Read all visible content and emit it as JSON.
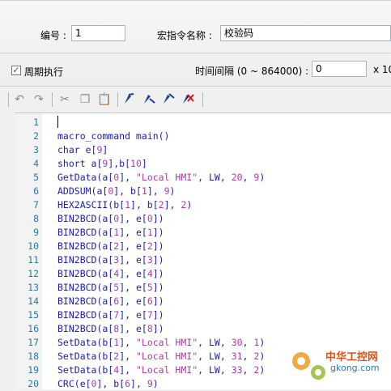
{
  "form": {
    "number_label": "编号 :",
    "number_value": "1",
    "macro_name_label": "宏指令名称 :",
    "macro_name_value": "校验码",
    "periodic_label": "周期执行",
    "periodic_checked": true,
    "interval_label": "时间间隔 (0 ~ 864000) :",
    "interval_value": "0",
    "interval_unit": "x 10"
  },
  "toolbar": {
    "items": [
      "undo-icon",
      "redo-icon",
      "cut-icon",
      "copy-icon",
      "paste-icon",
      "bookmark-icon",
      "bookmark-next-icon",
      "bookmark-prev-icon",
      "bookmark-clear-icon"
    ]
  },
  "editor": {
    "lines": [
      {
        "n": "1",
        "t": ""
      },
      {
        "n": "2",
        "t": "macro_command main()"
      },
      {
        "n": "3",
        "t": "char e[9]"
      },
      {
        "n": "4",
        "t": "short a[9],b[10]"
      },
      {
        "n": "5",
        "t": "GetData(a[0], \"Local HMI\", LW, 20, 9)"
      },
      {
        "n": "6",
        "t": "ADDSUM(a[0], b[1], 9)"
      },
      {
        "n": "7",
        "t": "HEX2ASCII(b[1], b[2], 2)"
      },
      {
        "n": "8",
        "t": "BIN2BCD(a[0], e[0])"
      },
      {
        "n": "9",
        "t": "BIN2BCD(a[1], e[1])"
      },
      {
        "n": "10",
        "t": "BIN2BCD(a[2], e[2])"
      },
      {
        "n": "11",
        "t": "BIN2BCD(a[3], e[3])"
      },
      {
        "n": "12",
        "t": "BIN2BCD(a[4], e[4])"
      },
      {
        "n": "13",
        "t": "BIN2BCD(a[5], e[5])"
      },
      {
        "n": "14",
        "t": "BIN2BCD(a[6], e[6])"
      },
      {
        "n": "15",
        "t": "BIN2BCD(a[7], e[7])"
      },
      {
        "n": "16",
        "t": "BIN2BCD(a[8], e[8])"
      },
      {
        "n": "17",
        "t": "SetData(b[1], \"Local HMI\", LW, 30, 1)"
      },
      {
        "n": "18",
        "t": "SetData(b[2], \"Local HMI\", LW, 31, 2)"
      },
      {
        "n": "19",
        "t": "SetData(b[4], \"Local HMI\", LW, 33, 2)"
      },
      {
        "n": "20",
        "t": "CRC(e[0], b[6], 9)"
      }
    ]
  },
  "watermark": {
    "title": "中华工控网",
    "url": "gkong.com"
  }
}
